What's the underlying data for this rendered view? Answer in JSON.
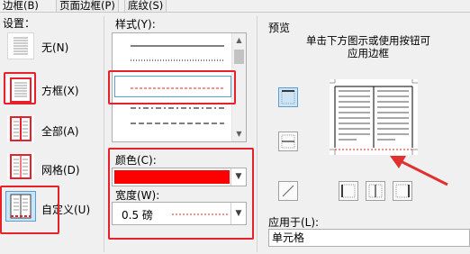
{
  "tabs": [
    {
      "label": "边框(B)"
    },
    {
      "label": "页面边框(P)"
    },
    {
      "label": "底纹(S)"
    }
  ],
  "settings": {
    "label": "设置：",
    "items": [
      {
        "label": "无(N)",
        "icon": "border-none-icon"
      },
      {
        "label": "方框(X)",
        "icon": "border-box-icon"
      },
      {
        "label": "全部(A)",
        "icon": "border-all-icon"
      },
      {
        "label": "网格(D)",
        "icon": "border-grid-icon"
      },
      {
        "label": "自定义(U)",
        "icon": "border-custom-icon"
      }
    ]
  },
  "style": {
    "label": "样式(Y):",
    "items": [
      "solid",
      "dotted",
      "dashed",
      "dash-dot"
    ],
    "selected": "dashed"
  },
  "color": {
    "label": "颜色(C):",
    "value": "#ff0000"
  },
  "width": {
    "label": "宽度(W):",
    "value": "0.5 磅"
  },
  "preview": {
    "label": "预览",
    "hint": "单击下方图示或使用按钮可应用边框"
  },
  "apply_to": {
    "label": "应用于(L):",
    "value": "单元格"
  },
  "colors": {
    "highlight": "#e8202a",
    "accent_red": "#ff0000",
    "selected_bg": "#cce4f7"
  }
}
